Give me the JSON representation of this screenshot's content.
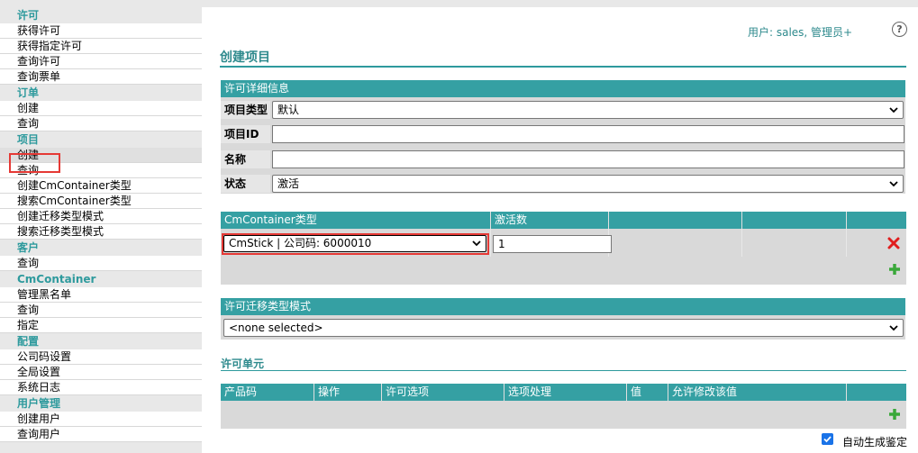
{
  "sidebar": {
    "sections": [
      {
        "title": "许可",
        "items": [
          "获得许可",
          "获得指定许可",
          "查询许可",
          "查询票单"
        ]
      },
      {
        "title": "订单",
        "items": [
          "创建",
          "查询"
        ]
      },
      {
        "title": "项目",
        "items": [
          "创建",
          "查询",
          "创建CmContainer类型",
          "搜索CmContainer类型",
          "创建迁移类型模式",
          "搜索迁移类型模式"
        ]
      },
      {
        "title": "客户",
        "items": [
          "查询"
        ]
      },
      {
        "title": "CmContainer",
        "items": [
          "管理黑名单",
          "查询",
          "指定"
        ]
      },
      {
        "title": "配置",
        "items": [
          "公司码设置",
          "全局设置",
          "系统日志"
        ]
      },
      {
        "title": "用户管理",
        "items": [
          "创建用户",
          "查询用户"
        ]
      }
    ],
    "active": "项目/创建"
  },
  "header": {
    "user_label": "用户: sales, 管理员+",
    "help_icon": "?"
  },
  "page_title": "创建项目",
  "license_details": {
    "heading": "许可详细信息",
    "project_type_label": "项目类型",
    "project_type_value": "默认",
    "project_id_label": "项目ID",
    "project_id_value": "",
    "name_label": "名称",
    "name_value": "",
    "status_label": "状态",
    "status_value": "激活"
  },
  "container_grid": {
    "headers": [
      "CmContainer类型",
      "激活数",
      "",
      "",
      ""
    ],
    "rows": [
      {
        "container_type": "CmStick | 公司码: 6000010",
        "activation_count": "1"
      }
    ]
  },
  "migration": {
    "heading": "许可迁移类型模式",
    "selected": "<none selected>"
  },
  "license_units": {
    "heading": "许可单元",
    "headers": [
      "产品码",
      "操作",
      "许可选项",
      "选项处理",
      "值",
      "允许修改该值"
    ]
  },
  "auto_generate_label": "自动生成鉴定",
  "auto_generate_checked": true,
  "colors": {
    "accent": "#35a0a3",
    "title": "#2e8a8d",
    "highlight": "#e53935"
  }
}
